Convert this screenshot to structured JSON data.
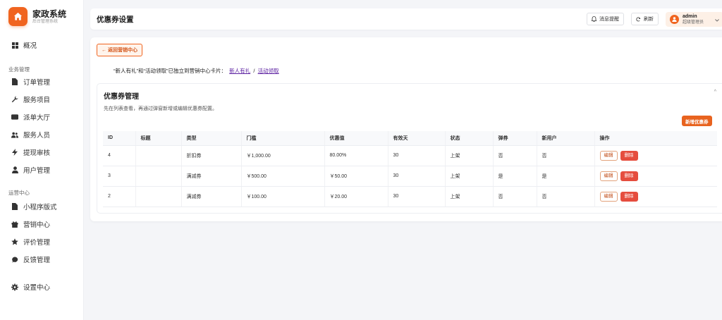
{
  "brand": {
    "title": "家政系统",
    "subtitle": "后台管理系统"
  },
  "sidebar": {
    "overview": "概况",
    "group_business": "业务管理",
    "business_items": [
      "订单管理",
      "服务项目",
      "派单大厅",
      "服务人员",
      "提现审核",
      "用户管理"
    ],
    "group_ops": "运营中心",
    "ops_items": [
      "小程序版式",
      "营销中心",
      "评价管理",
      "反馈管理"
    ],
    "settings": "设置中心"
  },
  "header": {
    "title": "优惠券设置",
    "notify_label": "消息提醒",
    "refresh_label": "刷新",
    "user_name": "admin",
    "user_role": "超级管理员"
  },
  "main": {
    "back_label": "← 返回营销中心",
    "notice_text": "“新人有礼”和“活动领取”已独立到营销中心卡片：",
    "notice_link1": "新人有礼",
    "notice_sep": "/",
    "notice_link2": "活动领取"
  },
  "coupon_panel": {
    "title": "优惠券管理",
    "collapse": "^",
    "hint": "先在列表查看，再通过弹窗新增或编辑优惠券配置。",
    "add_label": "新增优惠券",
    "columns": [
      "ID",
      "标题",
      "类型",
      "门槛",
      "优惠值",
      "有效天",
      "状态",
      "弹券",
      "新用户",
      "操作"
    ],
    "rows": [
      {
        "id": "4",
        "title": "",
        "type": "折扣券",
        "threshold": "￥1,000.00",
        "value": "80.00%",
        "days": "30",
        "status": "上架",
        "popup": "否",
        "new_user": "否"
      },
      {
        "id": "3",
        "title": "",
        "type": "满减券",
        "threshold": "￥500.00",
        "value": "￥50.00",
        "days": "30",
        "status": "上架",
        "popup": "是",
        "new_user": "是"
      },
      {
        "id": "2",
        "title": "",
        "type": "满减券",
        "threshold": "￥100.00",
        "value": "￥20.00",
        "days": "30",
        "status": "上架",
        "popup": "否",
        "new_user": "否"
      }
    ],
    "edit_label": "编辑",
    "delete_label": "删除"
  },
  "colors": {
    "accent": "#f0641f",
    "danger": "#e54d3e",
    "link": "#5a1ea0"
  }
}
